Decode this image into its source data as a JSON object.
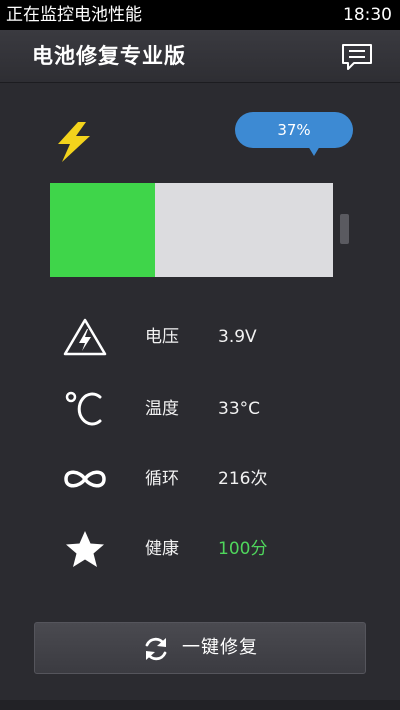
{
  "status_bar": {
    "notification": "正在监控电池性能",
    "time": "18:30"
  },
  "header": {
    "title": "电池修复专业版",
    "message_icon": "message-icon"
  },
  "battery": {
    "percent_label": "37%",
    "level": 0.37,
    "charging_icon": "lightning-bolt-icon",
    "fill_color": "#3fd54a"
  },
  "stats": [
    {
      "icon": "voltage-warning-icon",
      "label": "电压",
      "value": "3.9V"
    },
    {
      "icon": "celsius-icon",
      "label": "温度",
      "value": "33°C"
    },
    {
      "icon": "infinity-icon",
      "label": "循环",
      "value": "216次"
    },
    {
      "icon": "star-icon",
      "label": "健康",
      "value": "100分",
      "value_color": "#4fd65c"
    }
  ],
  "action_button": {
    "label": "一键修复",
    "icon": "refresh-icon"
  },
  "colors": {
    "background": "#2b2b30",
    "accent_blue": "#3d8ad3",
    "healthy_green": "#4fd65c"
  }
}
